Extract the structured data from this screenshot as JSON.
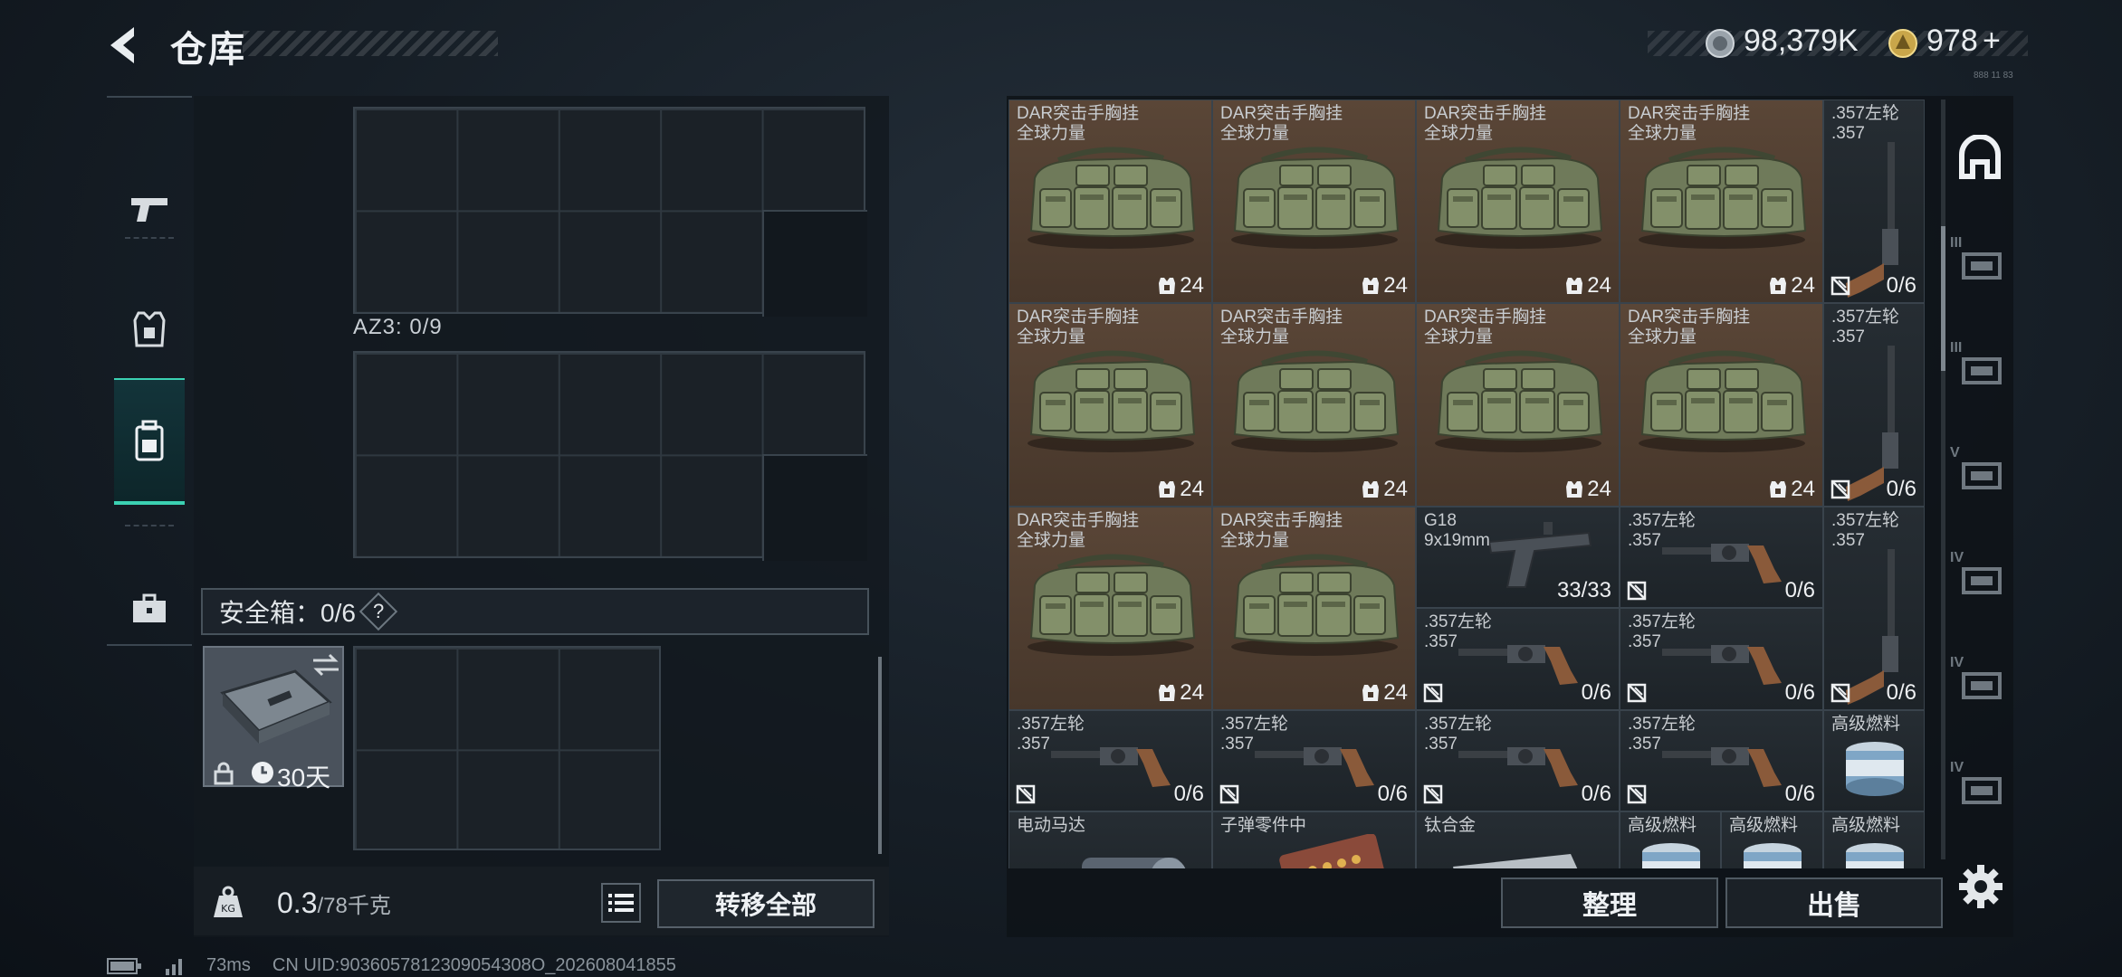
{
  "header": {
    "title": "仓库",
    "currency_1": "98,379K",
    "currency_2": "978",
    "currency_2_suffix": "+",
    "tiny_code": "888 11 83"
  },
  "left_nav": [
    {
      "icon": "pistol-icon"
    },
    {
      "icon": "armor-vest-icon"
    },
    {
      "icon": "backpack-icon",
      "active": true
    },
    {
      "icon": "briefcase-icon"
    }
  ],
  "loadout": {
    "az3_label": "AZ3: 0/9",
    "safe_box_label": "安全箱：0/6",
    "safe_help": "?",
    "safe_item_days": "30天"
  },
  "weight": {
    "current": "0.3",
    "max": "/78",
    "unit": "千克"
  },
  "buttons": {
    "transfer_all": "转移全部",
    "sort": "整理",
    "sell": "出售"
  },
  "stash_items": [
    {
      "name": "DAR突击手胸挂",
      "sub": "全球力量",
      "value": "24",
      "type": "vest"
    },
    {
      "name": "DAR突击手胸挂",
      "sub": "全球力量",
      "value": "24",
      "type": "vest"
    },
    {
      "name": "DAR突击手胸挂",
      "sub": "全球力量",
      "value": "24",
      "type": "vest"
    },
    {
      "name": "DAR突击手胸挂",
      "sub": "全球力量",
      "value": "24",
      "type": "vest"
    },
    {
      "name": "DAR突击手胸挂",
      "sub": "全球力量",
      "value": "24",
      "type": "vest"
    },
    {
      "name": "DAR突击手胸挂",
      "sub": "全球力量",
      "value": "24",
      "type": "vest"
    },
    {
      "name": "DAR突击手胸挂",
      "sub": "全球力量",
      "value": "24",
      "type": "vest"
    },
    {
      "name": "DAR突击手胸挂",
      "sub": "全球力量",
      "value": "24",
      "type": "vest"
    },
    {
      "name": "DAR突击手胸挂",
      "sub": "全球力量",
      "value": "24",
      "type": "vest"
    },
    {
      "name": "DAR突击手胸挂",
      "sub": "全球力量",
      "value": "24",
      "type": "vest"
    },
    {
      "name": ".357左轮",
      "sub": ".357",
      "value": "0/6",
      "type": "revolver-v"
    },
    {
      "name": ".357左轮",
      "sub": ".357",
      "value": "0/6",
      "type": "revolver-v"
    },
    {
      "name": ".357左轮",
      "sub": ".357",
      "value": "0/6",
      "type": "revolver-v"
    },
    {
      "name": "G18",
      "sub": "9x19mm",
      "value": "33/33",
      "type": "pistol"
    },
    {
      "name": ".357左轮",
      "sub": ".357",
      "value": "0/6",
      "type": "revolver"
    },
    {
      "name": ".357左轮",
      "sub": ".357",
      "value": "0/6",
      "type": "revolver"
    },
    {
      "name": ".357左轮",
      "sub": ".357",
      "value": "0/6",
      "type": "revolver"
    },
    {
      "name": ".357左轮",
      "sub": ".357",
      "value": "0/6",
      "type": "revolver"
    },
    {
      "name": ".357左轮",
      "sub": ".357",
      "value": "0/6",
      "type": "revolver"
    },
    {
      "name": ".357左轮",
      "sub": ".357",
      "value": "0/6",
      "type": "revolver"
    },
    {
      "name": ".357左轮",
      "sub": ".357",
      "value": "0/6",
      "type": "revolver"
    },
    {
      "name": "高级燃料",
      "sub": "",
      "value": "",
      "type": "fuel"
    },
    {
      "name": "电动马达",
      "sub": "",
      "value": "",
      "type": "motor"
    },
    {
      "name": "子弹零件中",
      "sub": "",
      "value": "",
      "type": "parts"
    },
    {
      "name": "钛合金",
      "sub": "",
      "value": "",
      "type": "alloy"
    },
    {
      "name": "高级燃料",
      "sub": "",
      "value": "",
      "type": "fuel"
    },
    {
      "name": "高级燃料",
      "sub": "",
      "value": "",
      "type": "fuel"
    },
    {
      "name": "高级燃料",
      "sub": "",
      "value": "",
      "type": "fuel"
    }
  ],
  "right_tabs": [
    {
      "icon": "home-tab-icon",
      "tier": ""
    },
    {
      "icon": "weapon-tab-icon",
      "tier": "III"
    },
    {
      "icon": "gear-tab-icon",
      "tier": "III"
    },
    {
      "icon": "equipment-tab-icon",
      "tier": "V"
    },
    {
      "icon": "supplies-tab-icon",
      "tier": "IV"
    },
    {
      "icon": "medical-tab-icon",
      "tier": "IV"
    },
    {
      "icon": "misc-tab-icon",
      "tier": "IV"
    }
  ],
  "footer": {
    "ping": "73ms",
    "uid": "CN UID:9036057812309054308O_202608041855"
  }
}
